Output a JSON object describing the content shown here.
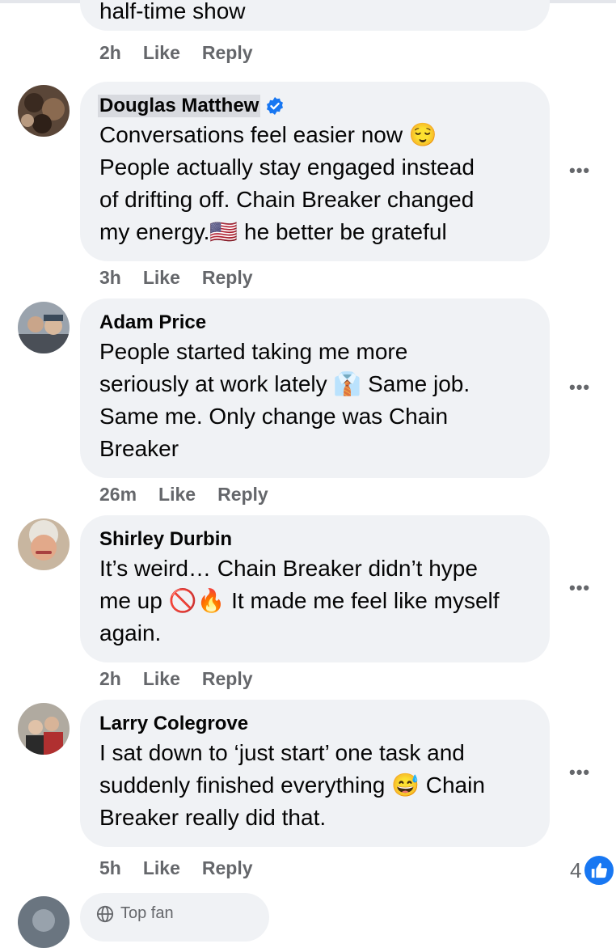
{
  "top_comment": {
    "partial_text": "half-time show",
    "time": "2h",
    "like": "Like",
    "reply": "Reply"
  },
  "comments": [
    {
      "name": "Douglas Matthew",
      "verified": true,
      "lines": [
        "Conversations feel easier now 😌",
        "People actually stay engaged instead",
        "of drifting off. Chain Breaker changed",
        "my energy.🇺🇸 he better be grateful"
      ],
      "time": "3h",
      "like": "Like",
      "reply": "Reply"
    },
    {
      "name": "Adam Price",
      "lines": [
        "People started taking me more",
        "seriously at work lately 👔 Same job.",
        "Same me. Only change was Chain",
        "Breaker"
      ],
      "time": "26m",
      "like": "Like",
      "reply": "Reply"
    },
    {
      "name": "Shirley Durbin",
      "lines": [
        "It’s weird… Chain Breaker didn’t hype",
        "me up 🚫🔥 It made me feel like myself",
        "again."
      ],
      "time": "2h",
      "like": "Like",
      "reply": "Reply"
    },
    {
      "name": "Larry Colegrove",
      "lines": [
        "I sat down to ‘just start’ one task and",
        "suddenly finished everything 😅 Chain",
        "Breaker really did that."
      ],
      "time": "5h",
      "like": "Like",
      "reply": "Reply",
      "reaction_count": "4"
    }
  ],
  "next_comment": {
    "badge": "Top fan"
  },
  "more_label": "•••"
}
